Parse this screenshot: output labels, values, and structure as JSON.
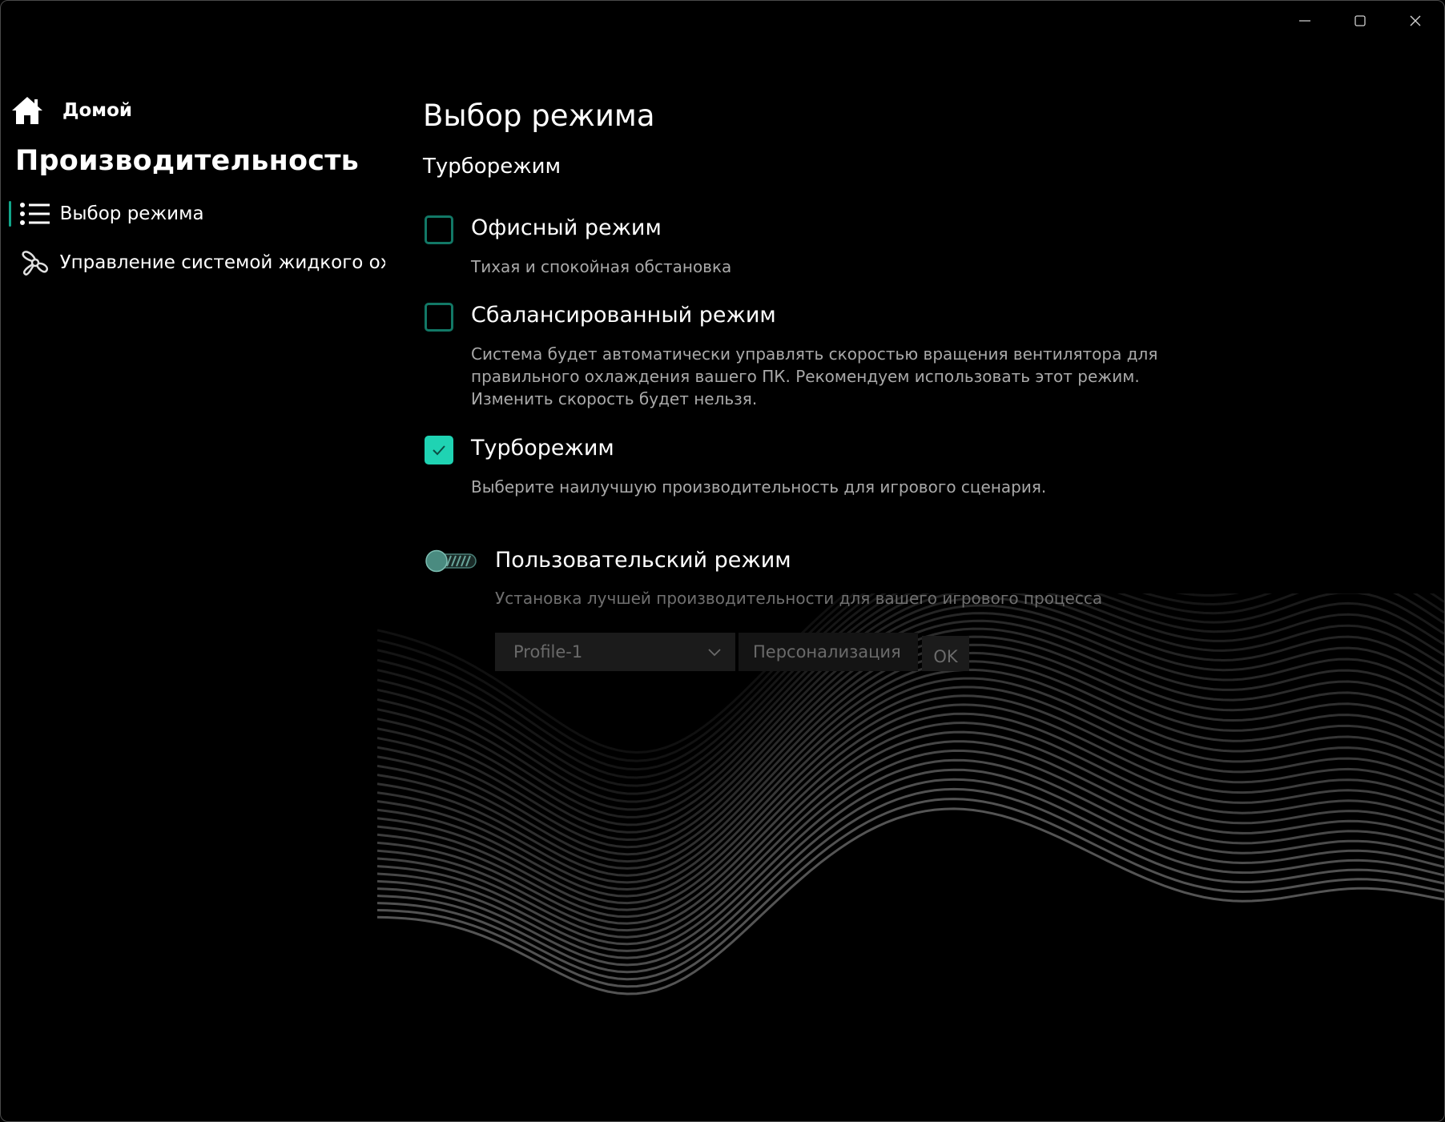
{
  "window": {
    "controls": {
      "minimize": "minimize-icon",
      "maximize": "maximize-icon",
      "close": "close-icon"
    }
  },
  "sidebar": {
    "home_label": "Домой",
    "section_title": "Производительность",
    "items": [
      {
        "label": "Выбор режима",
        "icon": "list-icon",
        "selected": true
      },
      {
        "label": "Управление системой жидкого охлаждения",
        "icon": "fan-icon",
        "selected": false
      }
    ]
  },
  "main": {
    "title": "Выбор режима",
    "current_mode": "Турборежим",
    "modes": [
      {
        "title": "Офисный режим",
        "description": "Тихая и спокойная обстановка",
        "checked": false
      },
      {
        "title": "Сбалансированный режим",
        "description": "Система будет автоматически управлять скоростью вращения вентилятора для правильного охлаждения вашего ПК. Рекомендуем использовать этот режим. Изменить скорость будет нельзя.",
        "checked": false
      },
      {
        "title": "Турборежим",
        "description": "Выберите наилучшую производительность для игрового сценария.",
        "checked": true
      }
    ],
    "custom": {
      "title": "Пользовательский режим",
      "description": "Установка лучшей производительности для вашего игрового процесса",
      "enabled": false,
      "profile_value": "Profile-1",
      "name_placeholder": "Персонализация",
      "ok_label": "OK"
    }
  },
  "colors": {
    "accent": "#1fd3b3",
    "accent_dark": "#127866",
    "background": "#000000",
    "muted_text": "#a9a9a9"
  }
}
